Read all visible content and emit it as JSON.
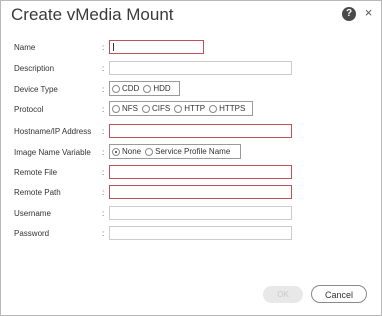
{
  "dialog": {
    "title": "Create vMedia Mount",
    "help_glyph": "?",
    "close_glyph": "×"
  },
  "form": {
    "separator": ":",
    "name_label": "Name",
    "name_value": "",
    "description_label": "Description",
    "description_value": "",
    "device_type_label": "Device Type",
    "device_type_options": [
      "CDD",
      "HDD"
    ],
    "device_type_selected": "",
    "protocol_label": "Protocol",
    "protocol_options": [
      "NFS",
      "CIFS",
      "HTTP",
      "HTTPS"
    ],
    "protocol_selected": "",
    "hostname_label": "Hostname/IP Address",
    "hostname_value": "",
    "image_name_variable_label": "Image Name Variable",
    "image_name_variable_options": [
      "None",
      "Service Profile Name"
    ],
    "image_name_variable_selected": "None",
    "remote_file_label": "Remote File",
    "remote_file_value": "",
    "remote_path_label": "Remote Path",
    "remote_path_value": "",
    "username_label": "Username",
    "username_value": "",
    "password_label": "Password",
    "password_value": ""
  },
  "footer": {
    "ok_label": "OK",
    "cancel_label": "Cancel"
  },
  "colors": {
    "required_border": "#c0505a",
    "help_button_bg": "#4a4a4a",
    "disabled_button_bg": "#e8e8e8"
  }
}
